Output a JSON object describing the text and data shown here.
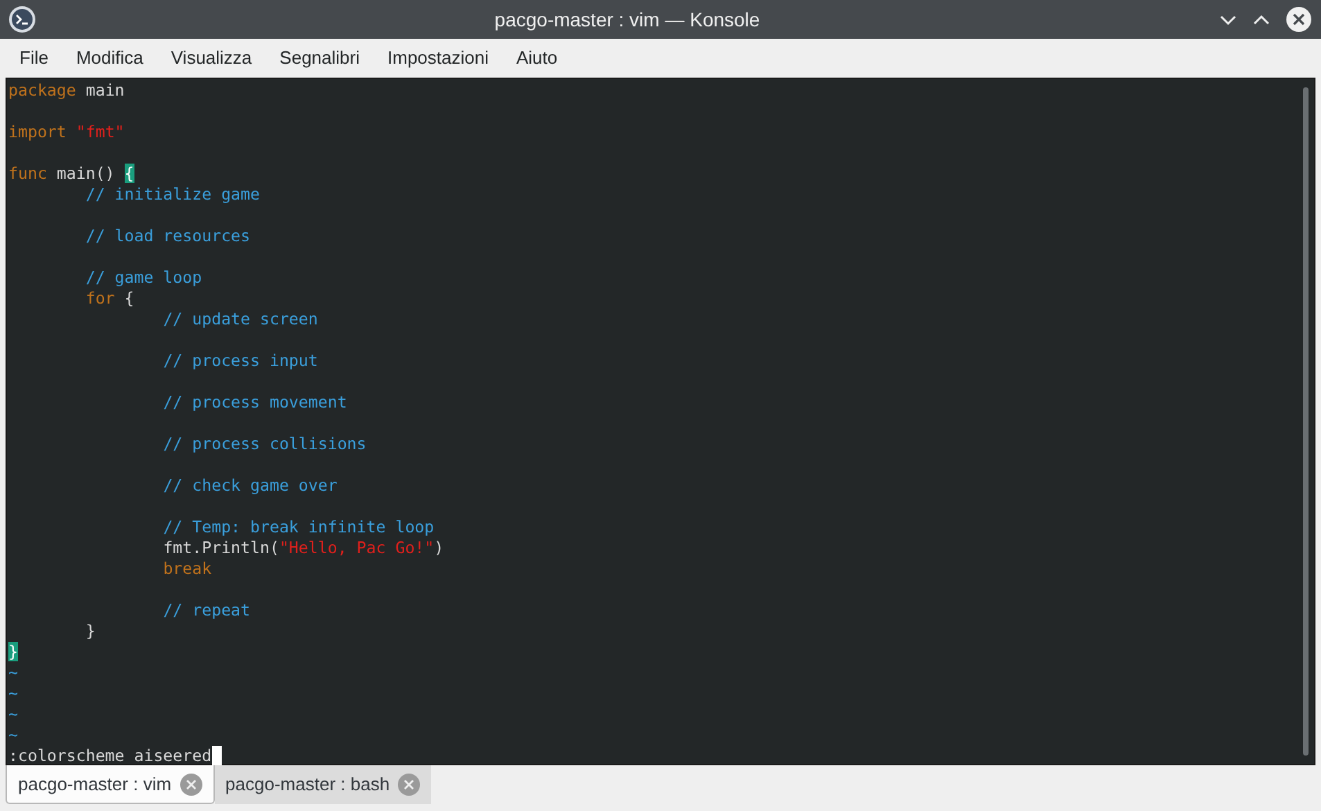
{
  "window": {
    "title": "pacgo-master : vim — Konsole"
  },
  "menu": [
    "File",
    "Modifica",
    "Visualizza",
    "Segnalibri",
    "Impostazioni",
    "Aiuto"
  ],
  "editor": {
    "lines": [
      {
        "gap_before": false,
        "segments": [
          {
            "kind": "keyword",
            "text": "package"
          },
          {
            "kind": "plain",
            "text": " main"
          }
        ]
      },
      {
        "gap_before": true,
        "segments": [
          {
            "kind": "keyword",
            "text": "import "
          },
          {
            "kind": "string",
            "text": "\"fmt\""
          }
        ]
      },
      {
        "gap_before": true,
        "segments": [
          {
            "kind": "keyword",
            "text": "func"
          },
          {
            "kind": "plain",
            "text": " main() "
          },
          {
            "kind": "match",
            "text": "{"
          }
        ]
      },
      {
        "gap_before": false,
        "segments": [
          {
            "kind": "comment",
            "text": "\t// initialize game"
          }
        ]
      },
      {
        "gap_before": true,
        "segments": [
          {
            "kind": "comment",
            "text": "\t// load resources"
          }
        ]
      },
      {
        "gap_before": true,
        "segments": [
          {
            "kind": "comment",
            "text": "\t// game loop"
          }
        ]
      },
      {
        "gap_before": false,
        "segments": [
          {
            "kind": "keyword",
            "text": "\tfor"
          },
          {
            "kind": "plain",
            "text": " {"
          }
        ]
      },
      {
        "gap_before": false,
        "segments": [
          {
            "kind": "comment",
            "text": "\t\t// update screen"
          }
        ]
      },
      {
        "gap_before": true,
        "segments": [
          {
            "kind": "comment",
            "text": "\t\t// process input"
          }
        ]
      },
      {
        "gap_before": true,
        "segments": [
          {
            "kind": "comment",
            "text": "\t\t// process movement"
          }
        ]
      },
      {
        "gap_before": true,
        "segments": [
          {
            "kind": "comment",
            "text": "\t\t// process collisions"
          }
        ]
      },
      {
        "gap_before": true,
        "segments": [
          {
            "kind": "comment",
            "text": "\t\t// check game over"
          }
        ]
      },
      {
        "gap_before": true,
        "segments": [
          {
            "kind": "comment",
            "text": "\t\t// Temp: break infinite loop"
          }
        ]
      },
      {
        "gap_before": false,
        "segments": [
          {
            "kind": "plain",
            "text": "\t\tfmt.Println("
          },
          {
            "kind": "string",
            "text": "\"Hello, Pac Go!\""
          },
          {
            "kind": "plain",
            "text": ")"
          }
        ]
      },
      {
        "gap_before": false,
        "segments": [
          {
            "kind": "keyword",
            "text": "\t\tbreak"
          }
        ]
      },
      {
        "gap_before": true,
        "segments": [
          {
            "kind": "comment",
            "text": "\t\t// repeat"
          }
        ]
      },
      {
        "gap_before": false,
        "segments": [
          {
            "kind": "plain",
            "text": "\t}"
          }
        ]
      },
      {
        "gap_before": false,
        "segments": [
          {
            "kind": "match",
            "text": "}"
          }
        ]
      },
      {
        "gap_before": false,
        "segments": [
          {
            "kind": "tilde",
            "text": "~"
          }
        ]
      },
      {
        "gap_before": false,
        "segments": [
          {
            "kind": "tilde",
            "text": "~"
          }
        ]
      },
      {
        "gap_before": false,
        "segments": [
          {
            "kind": "tilde",
            "text": "~"
          }
        ]
      },
      {
        "gap_before": false,
        "segments": [
          {
            "kind": "tilde",
            "text": "~"
          }
        ]
      }
    ],
    "command_line": ":colorscheme aiseered"
  },
  "tabs": [
    {
      "label": "pacgo-master : vim",
      "selected": true
    },
    {
      "label": "pacgo-master : bash",
      "selected": false
    }
  ]
}
